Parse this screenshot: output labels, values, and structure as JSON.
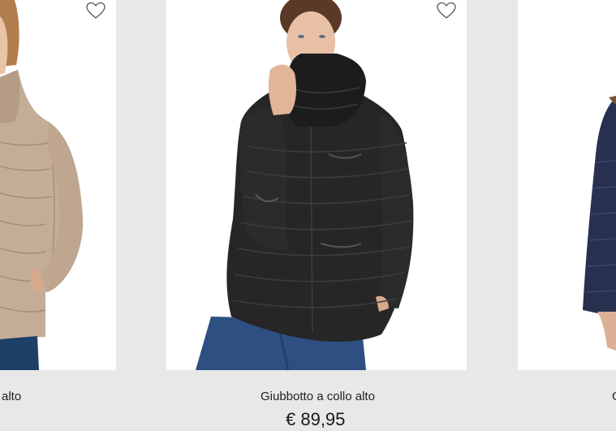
{
  "products": [
    {
      "title": "alto",
      "price": "",
      "color": "#c0a993",
      "favorite_icon": "heart-outline-icon"
    },
    {
      "title": "Giubbotto a collo alto",
      "price": "€ 89,95",
      "color": "#1f1f1f",
      "favorite_icon": "heart-outline-icon"
    },
    {
      "title": "G",
      "price": "",
      "color": "#27304f",
      "favorite_icon": "heart-outline-icon"
    }
  ]
}
